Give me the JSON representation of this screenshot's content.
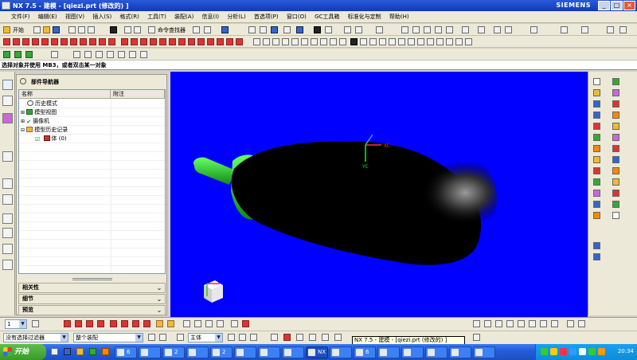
{
  "window": {
    "title": "NX 7.5 - 建模 - [qiezi.prt (修改的) ]",
    "brand": "SIEMENS",
    "controls": {
      "minimize": "_",
      "maximize": "□",
      "close": "×"
    }
  },
  "menu": {
    "items": [
      "文件(F)",
      "编辑(E)",
      "视图(V)",
      "插入(S)",
      "格式(R)",
      "工具(T)",
      "装配(A)",
      "信息(I)",
      "分析(L)",
      "首选项(P)",
      "窗口(O)",
      "GC工具箱",
      "标准化与定制",
      "帮助(H)"
    ]
  },
  "toolbar": {
    "start_label": "开始",
    "command_finder": "命令查找器"
  },
  "cue_line": "选择对象并使用 MB3，或者双击某一对象",
  "navigator": {
    "title": "部件导航器",
    "columns": [
      "名称",
      "附注"
    ],
    "nodes": [
      {
        "label": "历史模式",
        "icon": "history-mode-icon"
      },
      {
        "label": "模型视图",
        "icon": "model-views-icon"
      },
      {
        "label": "摄像机",
        "icon": "camera-icon"
      },
      {
        "label": "模型历史记录",
        "icon": "folder-icon"
      },
      {
        "label": "体 (0)",
        "icon": "body-feature-icon"
      }
    ],
    "panels": [
      "相关性",
      "细节",
      "预览"
    ]
  },
  "viewport": {
    "background": "#0000ff",
    "model_body_color": "#000000",
    "stem_color": "#22cc22",
    "axes": {
      "x": "XC",
      "y": "YC"
    }
  },
  "bottom_toolbar": {
    "selection_filter": "没有选择过滤器",
    "scope": "整个装配",
    "main_label": "主体",
    "layer_value": "1"
  },
  "tooltip": "NX 7.5 - 建模 - [qiezi.prt (修改的) ]",
  "taskbar": {
    "start": "开始",
    "tasks": [
      "6",
      "",
      "2",
      "",
      "2",
      "",
      "",
      "",
      "NX",
      "",
      "6",
      "",
      "",
      "",
      "",
      ""
    ],
    "clock": "20:34"
  }
}
